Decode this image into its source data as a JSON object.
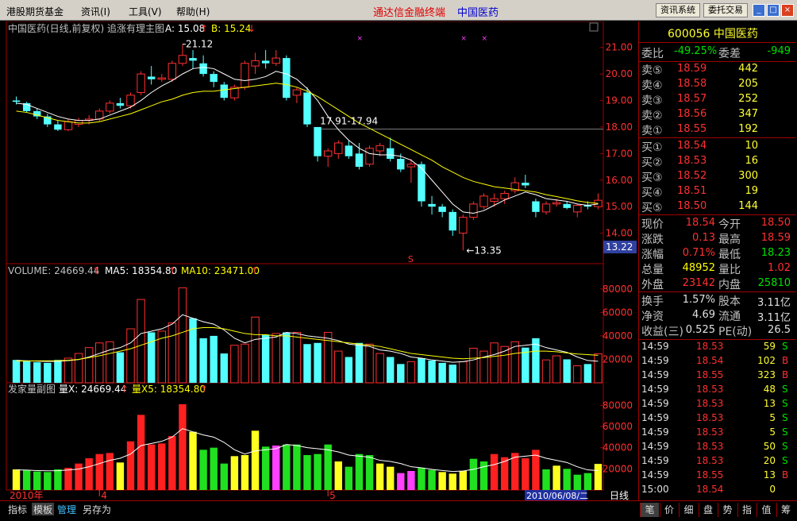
{
  "menu": {
    "items": [
      "港股期货基金",
      "资讯(I)",
      "工具(V)",
      "帮助(H)"
    ],
    "app_title": "通达信金融终端",
    "stock_title": "中国医药",
    "btn_news": "资讯系统",
    "btn_trade": "委托交易"
  },
  "colors": {
    "up": "#ff3030",
    "down": "#54ffff",
    "ma": "#ffff00",
    "white": "#ffffff",
    "green": "#00e000",
    "magenta": "#ff40ff",
    "label": "#c0c0c0"
  },
  "main_panel": {
    "header": "中国医药(日线,前复权) 追涨有理主图",
    "a_label": "A: 15.08",
    "b_label": "B: 15.24",
    "arrow_up": "↑",
    "arrow_dn": "↓",
    "high_label": "21.12",
    "low_label": "←13.35",
    "range_label": "17.91-17.94",
    "current_price_tag": "13.22",
    "s_marker": "S",
    "ylabels": [
      "21.00",
      "20.00",
      "19.00",
      "18.00",
      "17.00",
      "16.00",
      "15.00",
      "14.00"
    ]
  },
  "volume_panel": {
    "header": "VOLUME: 24669.44",
    "ma5": "MA5: 18354.80",
    "ma10": "MA10: 23471.00",
    "ylabels": [
      "80000",
      "60000",
      "40000",
      "20000"
    ]
  },
  "fa_panel": {
    "header": "发家量副图",
    "vx": "量X: 24669.44",
    "vx5": "量X5: 18354.80",
    "ylabels": [
      "80000",
      "60000",
      "40000",
      "20000"
    ]
  },
  "x_axis": {
    "labels": [
      "2010年",
      "4",
      "5"
    ],
    "date_box": "2010/06/08/二",
    "period": "日线"
  },
  "chart_data": {
    "type": "candlestick",
    "ohlc": [
      [
        19.0,
        19.15,
        18.85,
        18.95
      ],
      [
        18.9,
        18.95,
        18.55,
        18.6
      ],
      [
        18.6,
        18.7,
        18.3,
        18.4
      ],
      [
        18.4,
        18.5,
        18.0,
        18.1
      ],
      [
        18.1,
        18.25,
        17.85,
        17.9
      ],
      [
        17.9,
        18.3,
        17.85,
        18.2
      ],
      [
        18.1,
        18.35,
        18.0,
        18.25
      ],
      [
        18.25,
        18.45,
        18.1,
        18.3
      ],
      [
        18.3,
        18.7,
        18.2,
        18.6
      ],
      [
        18.6,
        19.0,
        18.5,
        18.9
      ],
      [
        18.9,
        19.1,
        18.7,
        18.8
      ],
      [
        18.8,
        19.3,
        18.7,
        19.2
      ],
      [
        19.3,
        20.1,
        19.2,
        20.0
      ],
      [
        19.9,
        20.3,
        19.6,
        19.8
      ],
      [
        19.8,
        20.0,
        19.7,
        19.85
      ],
      [
        19.8,
        20.5,
        19.7,
        20.4
      ],
      [
        20.4,
        21.12,
        20.3,
        20.7
      ],
      [
        20.6,
        20.9,
        20.2,
        20.5
      ],
      [
        20.4,
        20.7,
        19.9,
        20.0
      ],
      [
        20.0,
        20.1,
        19.5,
        19.7
      ],
      [
        19.6,
        19.7,
        19.0,
        19.1
      ],
      [
        19.1,
        19.6,
        19.0,
        19.5
      ],
      [
        19.5,
        20.5,
        19.4,
        20.4
      ],
      [
        20.3,
        20.8,
        20.0,
        20.5
      ],
      [
        20.5,
        20.9,
        20.2,
        20.4
      ],
      [
        20.4,
        20.9,
        20.3,
        20.6
      ],
      [
        20.6,
        20.7,
        19.0,
        19.1
      ],
      [
        19.2,
        19.5,
        18.9,
        19.4
      ],
      [
        19.3,
        19.5,
        18.0,
        18.1
      ],
      [
        18.0,
        18.0,
        16.7,
        16.9
      ],
      [
        16.9,
        17.2,
        16.5,
        17.1
      ],
      [
        17.0,
        17.5,
        16.8,
        17.4
      ],
      [
        17.3,
        17.5,
        16.8,
        16.9
      ],
      [
        17.0,
        17.4,
        16.4,
        16.5
      ],
      [
        16.6,
        17.3,
        16.5,
        17.2
      ],
      [
        17.1,
        17.4,
        16.9,
        17.3
      ],
      [
        17.2,
        17.6,
        16.7,
        16.8
      ],
      [
        16.8,
        17.0,
        16.3,
        16.4
      ],
      [
        16.5,
        16.8,
        15.9,
        16.6
      ],
      [
        16.6,
        16.7,
        15.0,
        15.2
      ],
      [
        15.1,
        15.4,
        14.7,
        15.0
      ],
      [
        15.0,
        15.1,
        14.6,
        14.8
      ],
      [
        14.8,
        14.9,
        13.9,
        14.1
      ],
      [
        14.0,
        14.7,
        13.35,
        14.6
      ],
      [
        14.6,
        15.2,
        14.5,
        15.1
      ],
      [
        15.0,
        15.5,
        14.9,
        15.4
      ],
      [
        15.2,
        15.5,
        15.0,
        15.3
      ],
      [
        15.3,
        15.6,
        15.1,
        15.5
      ],
      [
        15.6,
        16.1,
        15.5,
        15.9
      ],
      [
        15.9,
        16.2,
        15.7,
        15.8
      ],
      [
        15.2,
        15.3,
        14.6,
        14.8
      ],
      [
        14.8,
        15.2,
        14.7,
        15.1
      ],
      [
        15.1,
        15.3,
        15.0,
        15.15
      ],
      [
        15.1,
        15.2,
        14.9,
        14.95
      ],
      [
        14.8,
        15.1,
        14.6,
        15.05
      ],
      [
        15.05,
        15.2,
        14.9,
        15.0
      ],
      [
        15.0,
        15.5,
        14.9,
        15.24
      ]
    ],
    "ma_short": [
      18.9,
      18.85,
      18.7,
      18.55,
      18.4,
      18.3,
      18.25,
      18.25,
      18.3,
      18.45,
      18.6,
      18.75,
      19.0,
      19.3,
      19.55,
      19.75,
      20.0,
      20.2,
      20.25,
      20.2,
      20.0,
      19.8,
      19.75,
      19.8,
      19.9,
      20.1,
      20.0,
      19.8,
      19.45,
      19.0,
      18.4,
      17.9,
      17.5,
      17.2,
      17.0,
      16.95,
      16.95,
      16.9,
      16.75,
      16.45,
      16.0,
      15.55,
      15.1,
      14.8,
      14.75,
      14.85,
      15.05,
      15.25,
      15.4,
      15.55,
      15.45,
      15.3,
      15.25,
      15.2,
      15.1,
      15.05,
      15.1
    ],
    "ma_long": [
      18.6,
      18.55,
      18.45,
      18.35,
      18.25,
      18.2,
      18.15,
      18.15,
      18.2,
      18.3,
      18.4,
      18.5,
      18.65,
      18.8,
      18.95,
      19.05,
      19.2,
      19.3,
      19.35,
      19.35,
      19.4,
      19.45,
      19.5,
      19.55,
      19.6,
      19.65,
      19.6,
      19.5,
      19.35,
      19.15,
      18.9,
      18.65,
      18.4,
      18.15,
      17.95,
      17.75,
      17.55,
      17.35,
      17.15,
      16.95,
      16.75,
      16.5,
      16.3,
      16.1,
      15.95,
      15.85,
      15.75,
      15.7,
      15.65,
      15.6,
      15.55,
      15.45,
      15.38,
      15.3,
      15.22,
      15.16,
      15.12
    ],
    "volumes": [
      19500,
      19000,
      17500,
      17000,
      19500,
      21000,
      25000,
      30000,
      34000,
      35000,
      26000,
      46000,
      71000,
      43000,
      44000,
      51000,
      81000,
      55000,
      38000,
      40000,
      25000,
      32000,
      33000,
      56000,
      41000,
      42000,
      43000,
      43000,
      33000,
      34000,
      43000,
      27000,
      22000,
      34000,
      33000,
      25000,
      22000,
      16000,
      18000,
      21000,
      19000,
      17000,
      15500,
      18000,
      29500,
      27000,
      34000,
      31000,
      35000,
      30000,
      38000,
      19500,
      23000,
      20000,
      14500,
      16000,
      24669
    ],
    "vol_ma5": [
      19000,
      18800,
      18400,
      18200,
      18300,
      18900,
      19800,
      22000,
      25000,
      28000,
      30000,
      34000,
      42000,
      44000,
      46000,
      50000,
      58000,
      55000,
      52000,
      50000,
      45000,
      38000,
      34000,
      37000,
      38000,
      39000,
      43000,
      42000,
      40000,
      39000,
      38000,
      36000,
      33000,
      32000,
      31000,
      28000,
      27000,
      25000,
      22000,
      21000,
      19500,
      18500,
      17500,
      18000,
      19500,
      22000,
      24000,
      27000,
      31000,
      32000,
      33000,
      30000,
      28000,
      26000,
      22000,
      19000,
      18354
    ],
    "vol_ma10": [
      18500,
      18600,
      18700,
      18800,
      18900,
      19200,
      20000,
      21500,
      23000,
      25000,
      27000,
      29000,
      32000,
      35000,
      38000,
      40000,
      43000,
      46000,
      47000,
      47000,
      46000,
      44000,
      42000,
      41000,
      41000,
      40000,
      40000,
      39000,
      38000,
      37000,
      36000,
      35000,
      34000,
      33000,
      32000,
      31000,
      29000,
      27000,
      25000,
      24000,
      23000,
      22000,
      21000,
      20500,
      21000,
      21500,
      22500,
      23500,
      25000,
      26000,
      27000,
      27000,
      26500,
      25500,
      24500,
      24000,
      23471
    ],
    "fa_colors": [
      "y",
      "g",
      "g",
      "g",
      "g",
      "r",
      "r",
      "r",
      "r",
      "r",
      "y",
      "r",
      "r",
      "r",
      "r",
      "r",
      "r",
      "y",
      "g",
      "g",
      "g",
      "y",
      "y",
      "y",
      "g",
      "m",
      "g",
      "g",
      "g",
      "g",
      "g",
      "y",
      "g",
      "g",
      "g",
      "y",
      "y",
      "m",
      "m",
      "g",
      "g",
      "y",
      "y",
      "y",
      "g",
      "g",
      "r",
      "r",
      "r",
      "r",
      "r",
      "g",
      "y",
      "g",
      "g",
      "g",
      "y"
    ],
    "ylim_price": [
      13.0,
      21.5
    ],
    "ylim_vol": [
      0,
      90000
    ]
  },
  "quote": {
    "code_name": "600056 中国医药",
    "weibi_label": "委比",
    "weibi_val": "-49.25%",
    "weicha_label": "委差",
    "weicha_val": "-949",
    "sells": [
      {
        "label": "卖⑤",
        "price": "18.59",
        "vol": "442"
      },
      {
        "label": "卖④",
        "price": "18.58",
        "vol": "205"
      },
      {
        "label": "卖③",
        "price": "18.57",
        "vol": "252"
      },
      {
        "label": "卖②",
        "price": "18.56",
        "vol": "347"
      },
      {
        "label": "卖①",
        "price": "18.55",
        "vol": "192"
      }
    ],
    "buys": [
      {
        "label": "买①",
        "price": "18.54",
        "vol": "10"
      },
      {
        "label": "买②",
        "price": "18.53",
        "vol": "16"
      },
      {
        "label": "买③",
        "price": "18.52",
        "vol": "300"
      },
      {
        "label": "买④",
        "price": "18.51",
        "vol": "19"
      },
      {
        "label": "买⑤",
        "price": "18.50",
        "vol": "144"
      }
    ],
    "stats": [
      {
        "l1": "现价",
        "v1": "18.54",
        "l2": "今开",
        "v2": "18.50",
        "c1": "#ff3030",
        "c2": "#ff3030"
      },
      {
        "l1": "涨跌",
        "v1": "0.13",
        "l2": "最高",
        "v2": "18.59",
        "c1": "#ff3030",
        "c2": "#ff3030"
      },
      {
        "l1": "涨幅",
        "v1": "0.71%",
        "l2": "最低",
        "v2": "18.23",
        "c1": "#ff3030",
        "c2": "#00e000"
      },
      {
        "l1": "总量",
        "v1": "48952",
        "l2": "量比",
        "v2": "1.02",
        "c1": "#ffff00",
        "c2": "#ff3030"
      },
      {
        "l1": "外盘",
        "v1": "23142",
        "l2": "内盘",
        "v2": "25810",
        "c1": "#ff3030",
        "c2": "#00e000"
      }
    ],
    "fin": [
      {
        "l1": "换手",
        "v1": "1.57%",
        "l2": "股本",
        "v2": "3.11亿"
      },
      {
        "l1": "净资",
        "v1": "4.69",
        "l2": "流通",
        "v2": "3.11亿"
      },
      {
        "l1": "收益(三)",
        "v1": "0.525",
        "l2": "PE(动)",
        "v2": "26.5"
      }
    ],
    "ticks": [
      {
        "t": "14:59",
        "p": "18.53",
        "v": "59",
        "s": "S"
      },
      {
        "t": "14:59",
        "p": "18.54",
        "v": "102",
        "s": "B"
      },
      {
        "t": "14:59",
        "p": "18.55",
        "v": "323",
        "s": "B"
      },
      {
        "t": "14:59",
        "p": "18.53",
        "v": "48",
        "s": "S"
      },
      {
        "t": "14:59",
        "p": "18.53",
        "v": "13",
        "s": "S"
      },
      {
        "t": "14:59",
        "p": "18.53",
        "v": "5",
        "s": "S"
      },
      {
        "t": "14:59",
        "p": "18.53",
        "v": "5",
        "s": "S"
      },
      {
        "t": "14:59",
        "p": "18.53",
        "v": "50",
        "s": "S"
      },
      {
        "t": "14:59",
        "p": "18.53",
        "v": "20",
        "s": "S"
      },
      {
        "t": "14:59",
        "p": "18.55",
        "v": "13",
        "s": "B"
      },
      {
        "t": "15:00",
        "p": "18.54",
        "v": "0",
        "s": ""
      }
    ]
  },
  "bottom": {
    "tabs": [
      "指标",
      "模板",
      "管理",
      "另存为"
    ],
    "right_tabs": [
      "笔",
      "价",
      "细",
      "盘",
      "势",
      "指",
      "值",
      "筹"
    ]
  }
}
